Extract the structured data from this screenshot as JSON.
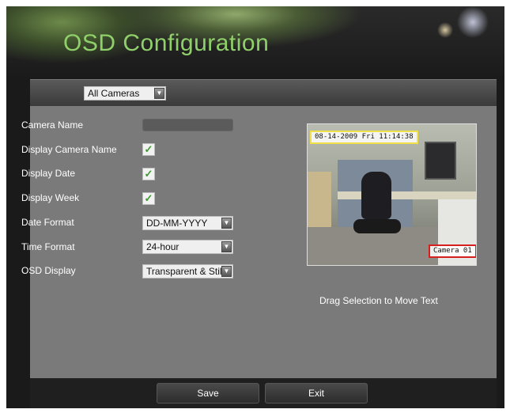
{
  "header": {
    "title": "OSD Configuration"
  },
  "camera_select": {
    "value": "All Cameras"
  },
  "form": {
    "camera_name": {
      "label": "Camera Name",
      "value": ""
    },
    "display_camera_name": {
      "label": "Display Camera Name",
      "checked": true
    },
    "display_date": {
      "label": "Display Date",
      "checked": true
    },
    "display_week": {
      "label": "Display Week",
      "checked": true
    },
    "date_format": {
      "label": "Date Format",
      "value": "DD-MM-YYYY"
    },
    "time_format": {
      "label": "Time Format",
      "value": "24-hour"
    },
    "osd_display": {
      "label": "OSD Display",
      "value": "Transparent & Still"
    }
  },
  "preview": {
    "date_overlay": "08-14-2009 Fri 11:14:38",
    "camera_overlay": "Camera 01",
    "hint": "Drag Selection to Move Text"
  },
  "buttons": {
    "save": "Save",
    "exit": "Exit"
  },
  "icons": {
    "check": "✓",
    "dropdown": "▼"
  },
  "colors": {
    "title": "#8fd06a",
    "check": "#3c9a2d",
    "date_box": "#f0e14a",
    "camera_box": "#d62020"
  }
}
